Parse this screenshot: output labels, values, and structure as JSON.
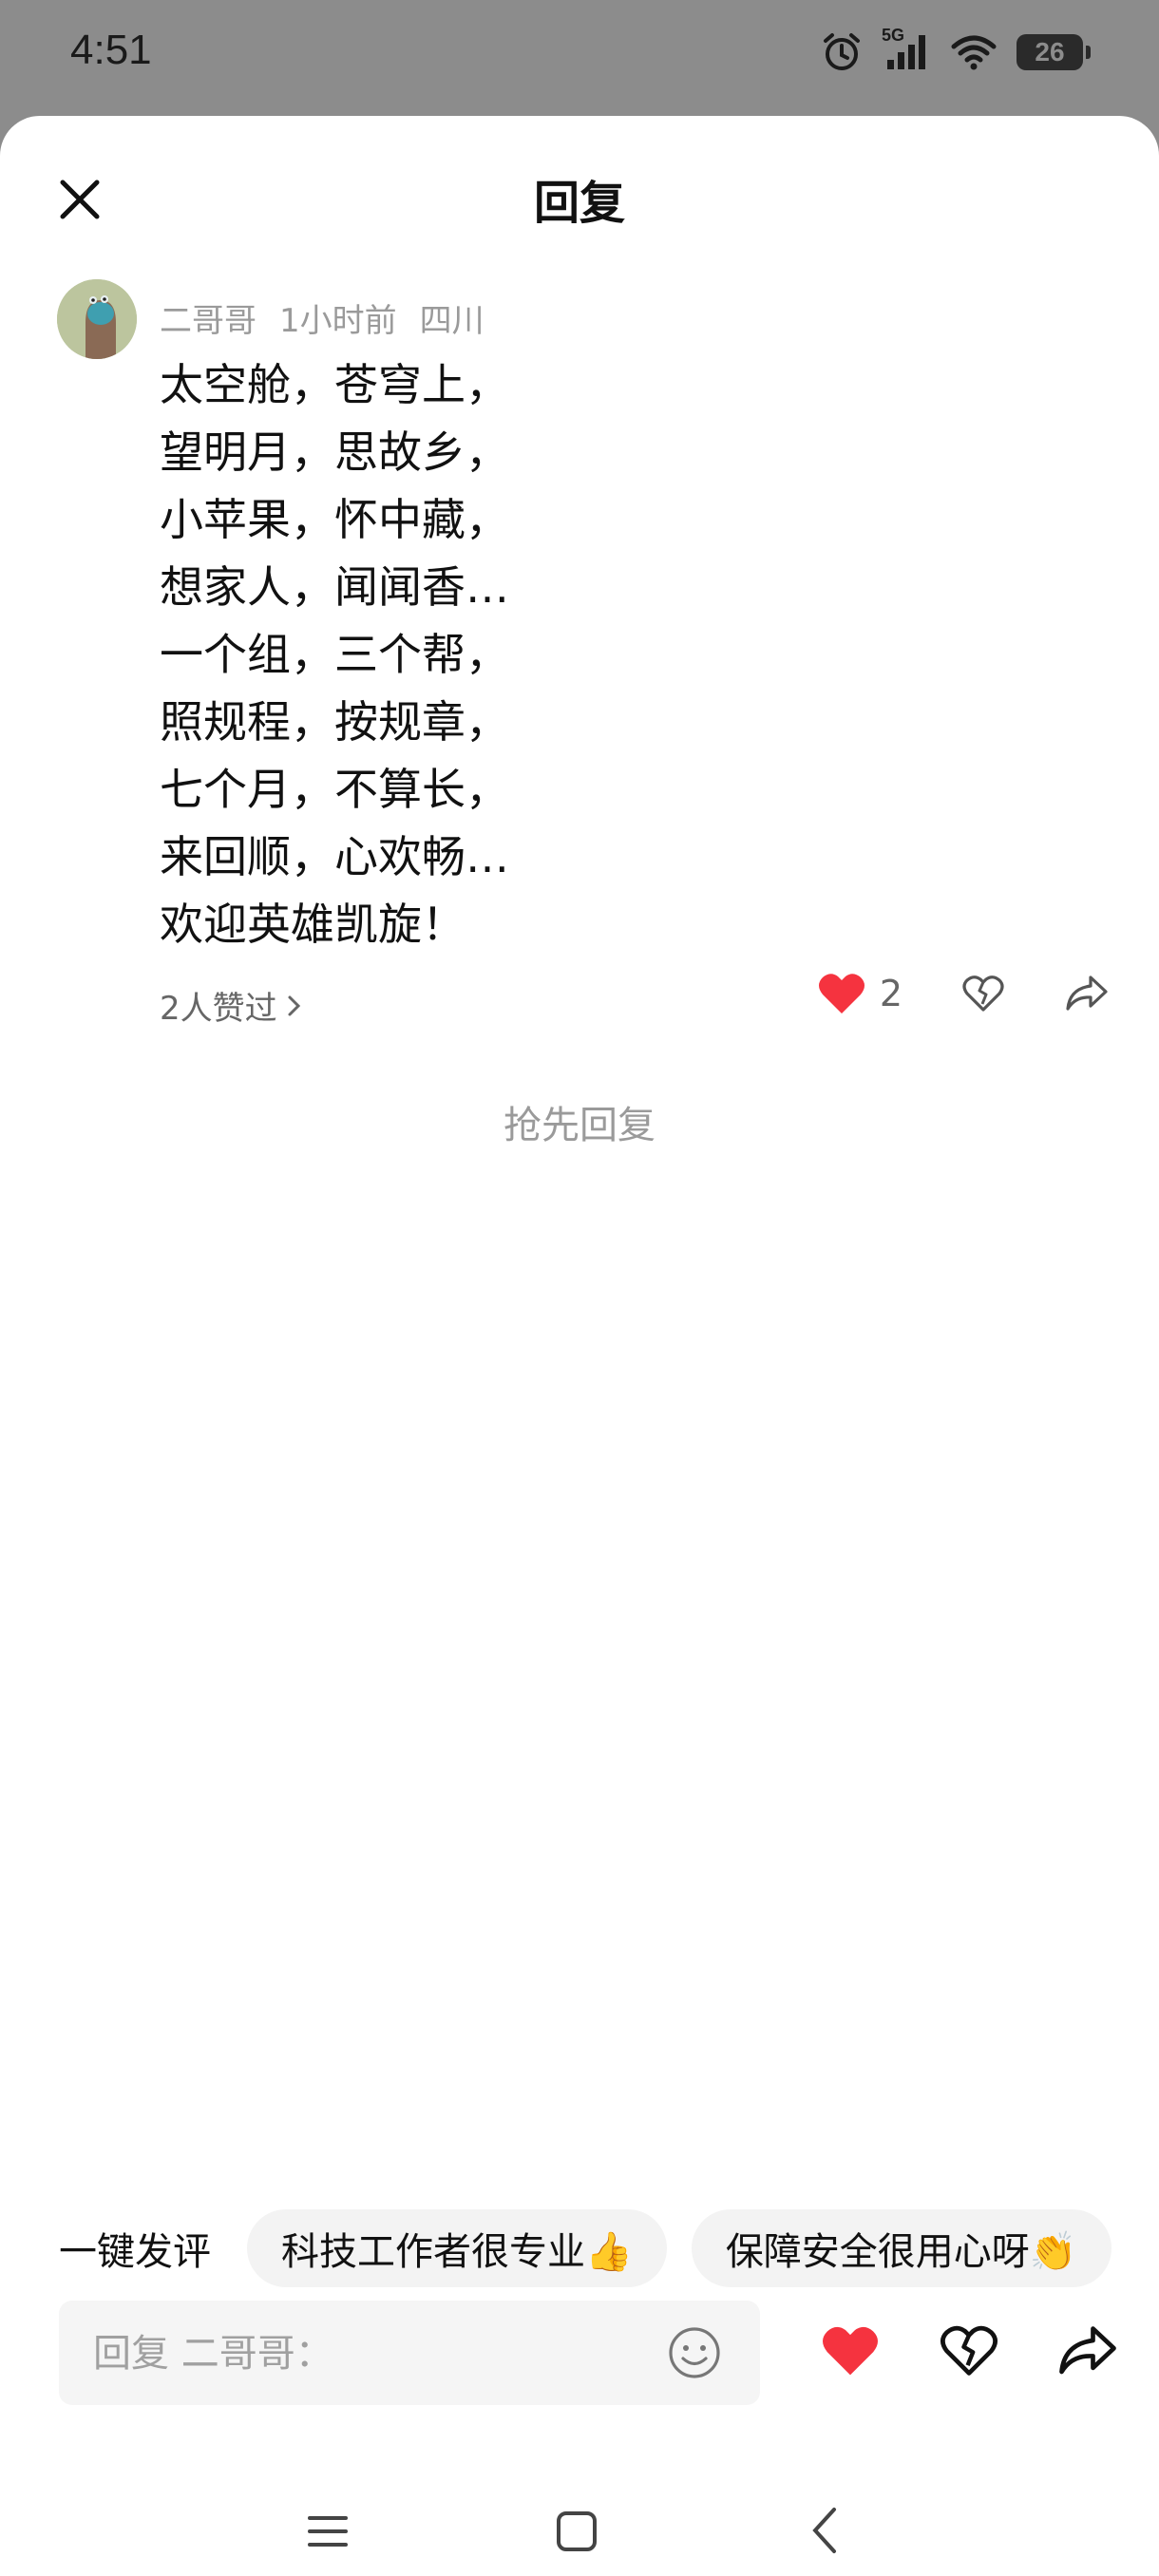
{
  "status_bar": {
    "time": "4:51",
    "network": "5G",
    "battery": "26"
  },
  "header": {
    "title": "回复"
  },
  "comment": {
    "author": "二哥哥",
    "time_ago": "1小时前",
    "location": "四川",
    "lines": [
      "太空舱，苍穹上，",
      "望明月，思故乡，",
      "小苹果，怀中藏，",
      "想家人，闻闻香…",
      "一个组，三个帮，",
      "照规程，按规章，",
      "七个月，不算长，",
      "来回顺，心欢畅…",
      "欢迎英雄凯旋！"
    ],
    "likes_text": "2人赞过",
    "like_count": "2"
  },
  "empty_state": {
    "text": "抢先回复"
  },
  "quick_comments": {
    "label": "一键发评",
    "chips": [
      "科技工作者很专业👍",
      "保障安全很用心呀👏"
    ]
  },
  "composer": {
    "placeholder": "回复 二哥哥："
  },
  "colors": {
    "like_red": "#f5333f",
    "status_bg": "#8c8c8c"
  },
  "icons": {
    "close": "close-icon",
    "heart": "heart-icon",
    "broken_heart": "broken-heart-icon",
    "share": "share-icon",
    "emoji": "emoji-icon"
  }
}
